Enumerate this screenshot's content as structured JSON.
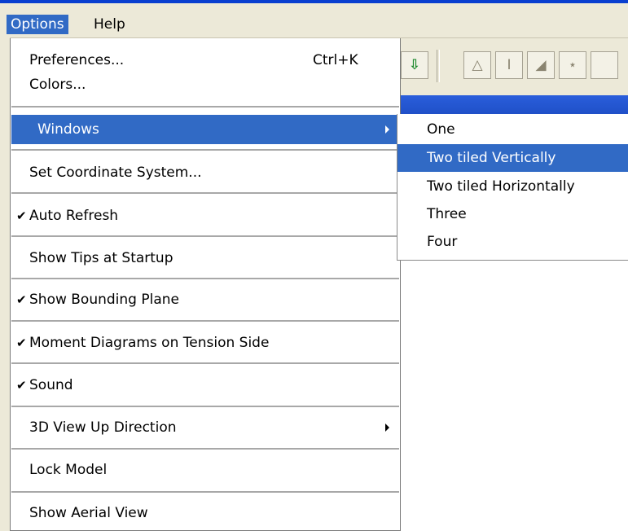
{
  "menubar": {
    "options_label": "Options",
    "help_label": "Help"
  },
  "toolbar": {
    "buttons": [
      "arrow-down-icon",
      "support-icon",
      "i-beam-icon",
      "ramp-icon",
      "figure-icon"
    ]
  },
  "options_menu": {
    "items": [
      {
        "label": "Preferences...",
        "shortcut": "Ctrl+K"
      },
      {
        "label": "Colors..."
      },
      {
        "label": "Windows",
        "submenu": true,
        "highlighted": true
      },
      {
        "label": "Set Coordinate System..."
      },
      {
        "label": "Auto Refresh",
        "checked": true
      },
      {
        "label": "Show Tips at Startup"
      },
      {
        "label": "Show Bounding Plane",
        "checked": true
      },
      {
        "label": "Moment Diagrams on Tension Side",
        "checked": true
      },
      {
        "label": "Sound",
        "checked": true
      },
      {
        "label": "3D View Up Direction",
        "submenu": true
      },
      {
        "label": "Lock Model"
      },
      {
        "label": "Show Aerial View"
      }
    ],
    "check_glyph": "✔"
  },
  "windows_submenu": {
    "items": [
      {
        "label": "One"
      },
      {
        "label": "Two tiled Vertically",
        "highlighted": true
      },
      {
        "label": "Two tiled Horizontally"
      },
      {
        "label": "Three"
      },
      {
        "label": "Four"
      }
    ]
  },
  "colors": {
    "highlight": "#316ac5",
    "menubar_bg": "#ece9d8",
    "title_blue": "#0a3fd0"
  }
}
